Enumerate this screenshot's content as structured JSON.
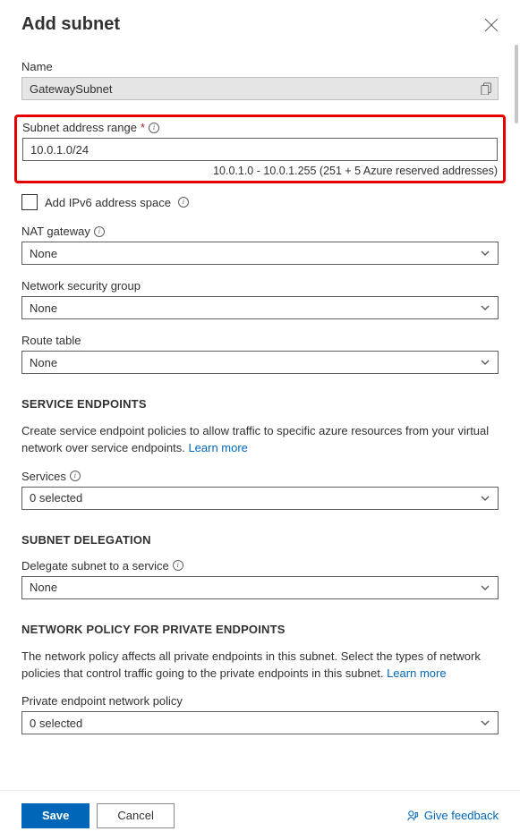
{
  "title": "Add subnet",
  "name": {
    "label": "Name",
    "value": "GatewaySubnet"
  },
  "subnet_range": {
    "label": "Subnet address range",
    "value": "10.0.1.0/24",
    "hint": "10.0.1.0 - 10.0.1.255 (251 + 5 Azure reserved addresses)"
  },
  "ipv6_checkbox": "Add IPv6 address space",
  "nat_gateway": {
    "label": "NAT gateway",
    "value": "None"
  },
  "nsg": {
    "label": "Network security group",
    "value": "None"
  },
  "route_table": {
    "label": "Route table",
    "value": "None"
  },
  "service_endpoints": {
    "header": "SERVICE ENDPOINTS",
    "desc": "Create service endpoint policies to allow traffic to specific azure resources from your virtual network over service endpoints.",
    "learn_more": "Learn more",
    "services_label": "Services",
    "services_value": "0 selected"
  },
  "delegation": {
    "header": "SUBNET DELEGATION",
    "label": "Delegate subnet to a service",
    "value": "None"
  },
  "network_policy": {
    "header": "NETWORK POLICY FOR PRIVATE ENDPOINTS",
    "desc": "The network policy affects all private endpoints in this subnet. Select the types of network policies that control traffic going to the private endpoints in this subnet.",
    "learn_more": "Learn more",
    "label": "Private endpoint network policy",
    "value": "0 selected"
  },
  "footer": {
    "save": "Save",
    "cancel": "Cancel",
    "feedback": "Give feedback"
  }
}
